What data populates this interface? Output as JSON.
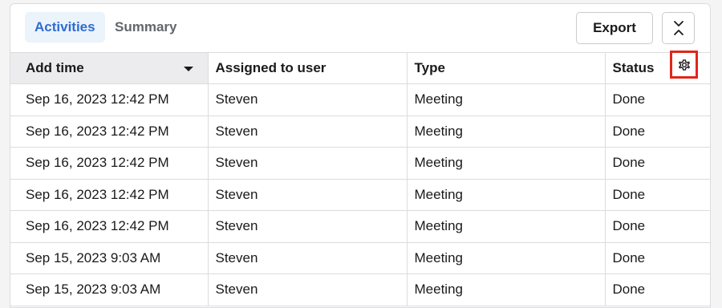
{
  "tabs": [
    {
      "label": "Activities",
      "active": true
    },
    {
      "label": "Summary",
      "active": false
    }
  ],
  "toolbar": {
    "export_label": "Export",
    "collapse_icon": "collapse-icon"
  },
  "table": {
    "columns": [
      "Add time",
      "Assigned to user",
      "Type",
      "Status"
    ],
    "sorted_column": "Add time",
    "sort_direction": "descending",
    "settings_icon": "gear-icon",
    "rows": [
      {
        "add_time": "Sep 16, 2023 12:42 PM",
        "user": "Steven",
        "type": "Meeting",
        "status": "Done"
      },
      {
        "add_time": "Sep 16, 2023 12:42 PM",
        "user": "Steven",
        "type": "Meeting",
        "status": "Done"
      },
      {
        "add_time": "Sep 16, 2023 12:42 PM",
        "user": "Steven",
        "type": "Meeting",
        "status": "Done"
      },
      {
        "add_time": "Sep 16, 2023 12:42 PM",
        "user": "Steven",
        "type": "Meeting",
        "status": "Done"
      },
      {
        "add_time": "Sep 16, 2023 12:42 PM",
        "user": "Steven",
        "type": "Meeting",
        "status": "Done"
      },
      {
        "add_time": "Sep 15, 2023 9:03 AM",
        "user": "Steven",
        "type": "Meeting",
        "status": "Done"
      },
      {
        "add_time": "Sep 15, 2023 9:03 AM",
        "user": "Steven",
        "type": "Meeting",
        "status": "Done"
      }
    ]
  },
  "colors": {
    "accent": "#2f6cd1",
    "active_tab_bg": "#ebf3fb",
    "highlight_border": "#e0261a",
    "sorted_header_bg": "#ececee"
  }
}
